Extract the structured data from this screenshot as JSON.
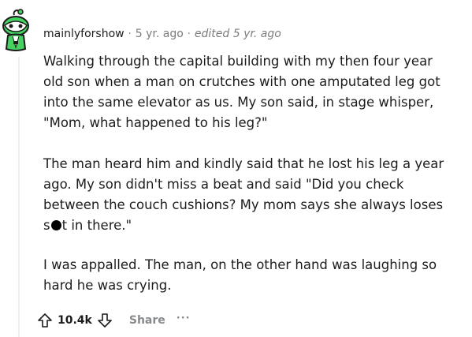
{
  "comment": {
    "author": "mainlyforshow",
    "separator": "·",
    "age": "5 yr. ago",
    "edited": "edited 5 yr. ago",
    "paragraphs": [
      {
        "lines": [
          "Walking through the capital building with my then four year",
          "old son when a man on crutches with one amputated leg got",
          "into the same elevator as us. My son said, in stage whisper,",
          "\"Mom, what happened to his leg?\""
        ]
      },
      {
        "lines": [
          "The man heard him and kindly said that he lost his leg a year",
          "ago. My son didn't miss a beat and said \"Did you check",
          "between the couch cushions? My mom says she always loses"
        ],
        "last_line_before": "s",
        "last_line_after": "t in there.\""
      },
      {
        "lines": [
          "I was appalled. The man, on the other hand was laughing so",
          "hard he was crying."
        ]
      }
    ]
  },
  "actions": {
    "upvote_icon": "arrow-up-icon",
    "score": "10.4k",
    "downvote_icon": "arrow-down-icon",
    "share_label": "Share",
    "more_label": "···"
  },
  "colors": {
    "text": "#1c1c1c",
    "meta": "#7c7c7c",
    "action": "#878a8c",
    "avatar_green": "#46d160"
  }
}
